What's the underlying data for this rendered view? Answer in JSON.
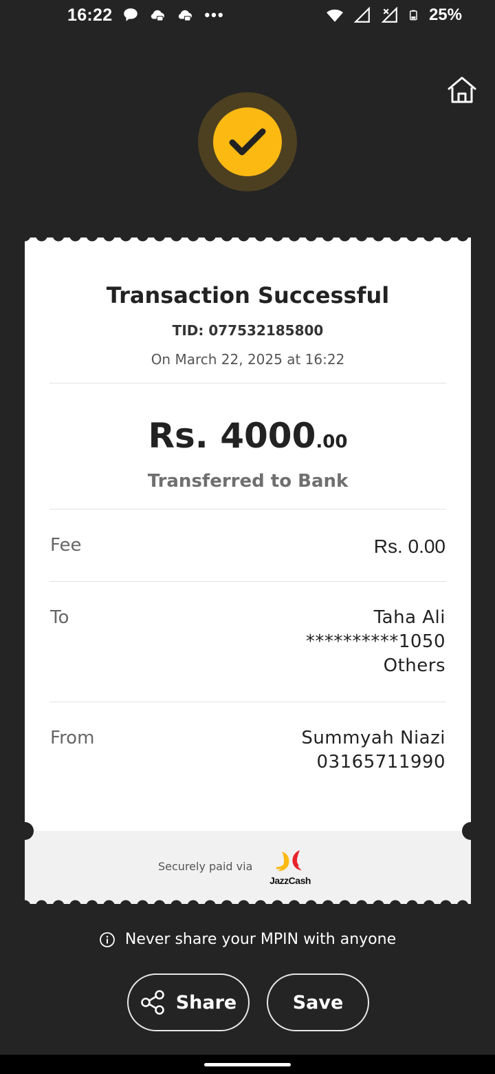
{
  "status_bar": {
    "time": "16:22",
    "battery": "25%",
    "dots": "•••",
    "icons": [
      "chat-bubble-icon",
      "cloud-message-icon",
      "cloud-message-icon",
      "more-dots-icon",
      "wifi-icon",
      "signal-icon",
      "signal-x-icon",
      "battery-icon"
    ]
  },
  "header": {
    "home_icon": "home-icon",
    "success_icon": "checkmark-icon",
    "accent": "#fcb912"
  },
  "receipt": {
    "title": "Transaction Successful",
    "tid": "TID: 077532185800",
    "date": "On March 22, 2025 at 16:22",
    "amount_main": "Rs. 4000",
    "amount_decimal": ".00",
    "amount_caption": "Transferred to Bank",
    "fee": {
      "label": "Fee",
      "value": "Rs. 0.00"
    },
    "to": {
      "label": "To",
      "name": "Taha Ali",
      "account": "**********1050",
      "bank": "Others"
    },
    "from": {
      "label": "From",
      "name": "Summyah Niazi",
      "phone": "03165711990"
    },
    "footer_text": "Securely paid via",
    "brand": "JazzCash"
  },
  "warning": {
    "icon": "info-icon",
    "text": "Never share your MPIN with anyone"
  },
  "actions": {
    "share_label": "Share",
    "share_icon": "share-icon",
    "save_label": "Save"
  }
}
